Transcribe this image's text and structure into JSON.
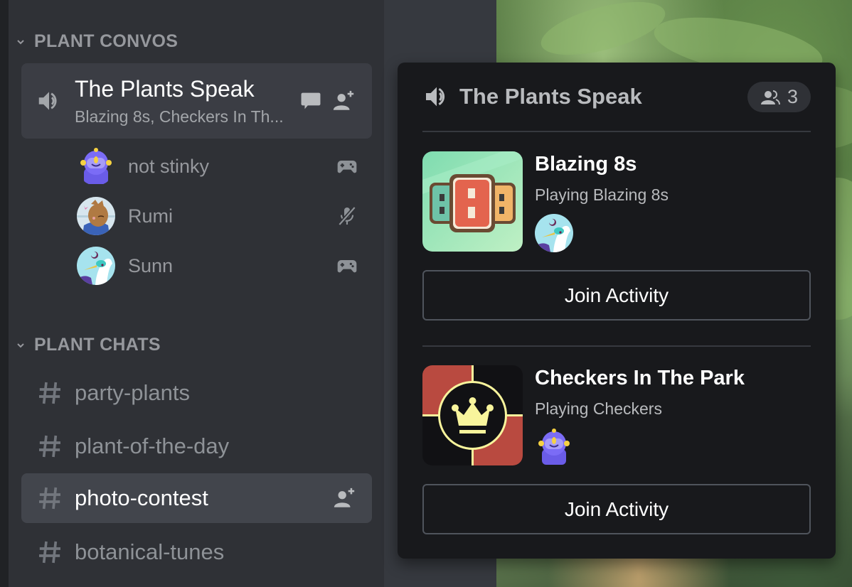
{
  "sidebar": {
    "categories": [
      {
        "label": "PLANT CONVOS",
        "icon": "chevron-down-icon"
      },
      {
        "label": "PLANT CHATS",
        "icon": "chevron-down-icon"
      }
    ],
    "voice_channel": {
      "name": "The Plants Speak",
      "subtitle": "Blazing 8s, Checkers In Th...",
      "icon": "speaker-activity-icon",
      "actions": [
        "chat-bubble-icon",
        "invite-member-icon"
      ],
      "users": [
        {
          "name": "not stinky",
          "avatar": "purple-robot",
          "status_icon": "gamepad-icon"
        },
        {
          "name": "Rumi",
          "avatar": "brown-dog-character",
          "status_icon": "mic-muted-icon"
        },
        {
          "name": "Sunn",
          "avatar": "white-bird-character",
          "status_icon": "gamepad-icon"
        }
      ]
    },
    "text_channels": [
      {
        "name": "party-plants",
        "selected": false
      },
      {
        "name": "plant-of-the-day",
        "selected": false
      },
      {
        "name": "photo-contest",
        "selected": true,
        "action_icon": "invite-member-icon"
      },
      {
        "name": "botanical-tunes",
        "selected": false
      }
    ]
  },
  "popout": {
    "title": "The Plants Speak",
    "member_count": "3",
    "activities": [
      {
        "name": "Blazing 8s",
        "state": "Playing Blazing 8s",
        "art": "blazing-8s-logo",
        "participants": [
          "Sunn"
        ],
        "button_label": "Join Activity"
      },
      {
        "name": "Checkers In The Park",
        "state": "Playing Checkers",
        "art": "checkers-crown-logo",
        "participants": [
          "not stinky"
        ],
        "button_label": "Join Activity"
      }
    ]
  },
  "colors": {
    "sidebar_bg": "#2f3136",
    "popout_bg": "#18191c",
    "selected_bg": "#42454c",
    "muted_text": "#96989d",
    "checkers_red": "#b94a40",
    "checkers_gold": "#f8f49c",
    "blazing_green": "#8ee0b0"
  }
}
